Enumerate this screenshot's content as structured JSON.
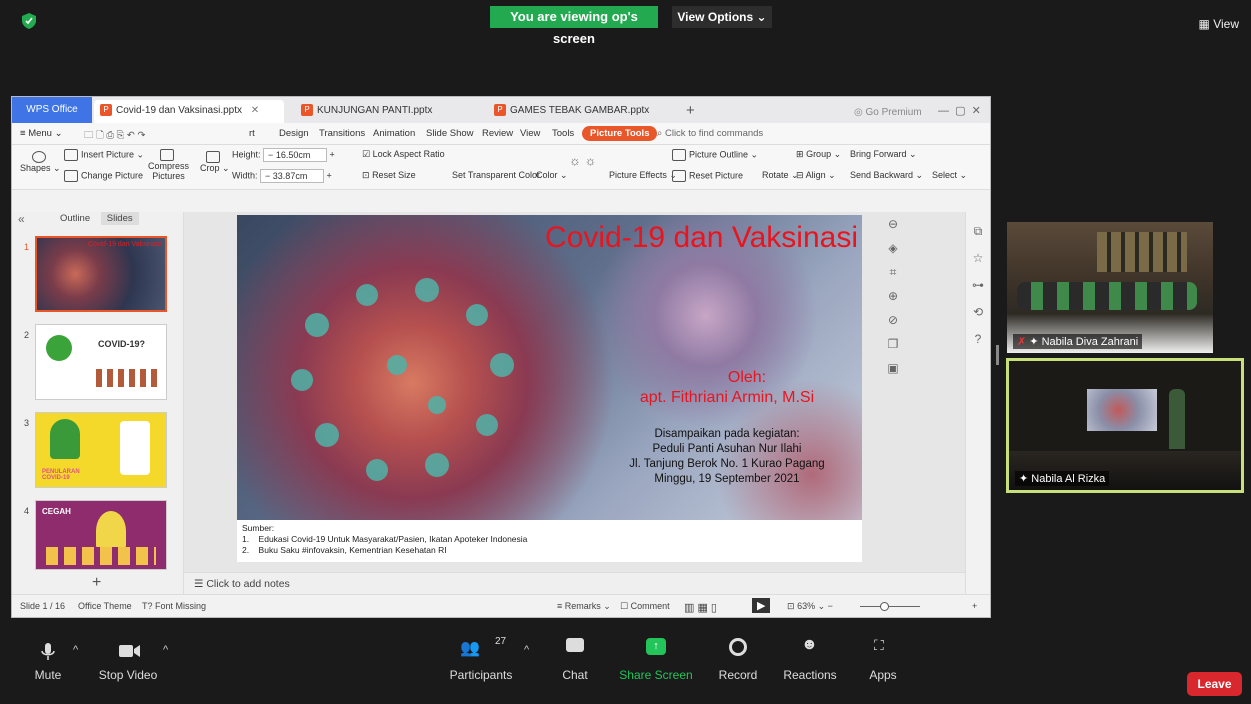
{
  "zoom": {
    "banner": "You are viewing op's screen",
    "view_options": "View Options",
    "view_button": "View",
    "toolbar": {
      "mute": "Mute",
      "stop_video": "Stop Video",
      "participants": "Participants",
      "participants_count": "27",
      "chat": "Chat",
      "share_screen": "Share Screen",
      "record": "Record",
      "reactions": "Reactions",
      "apps": "Apps",
      "leave": "Leave"
    },
    "participants": [
      {
        "name": "Nabila Diva Zahrani"
      },
      {
        "name": "Nabila Al Rizka"
      }
    ],
    "colors": {
      "banner": "#23a94f",
      "leave": "#d9272e",
      "active_speaker": "#c8e07a"
    }
  },
  "wps": {
    "tabs": [
      {
        "label": "WPS Office"
      },
      {
        "label": "Covid-19 dan Vaksinasi.pptx"
      },
      {
        "label": "KUNJUNGAN PANTI.pptx"
      },
      {
        "label": "GAMES TEBAK GAMBAR.pptx"
      }
    ],
    "go_premium": "Go Premium",
    "menu": {
      "menu": "Menu",
      "items": [
        "rt",
        "Design",
        "Transitions",
        "Animation",
        "Slide Show",
        "Review",
        "View",
        "Tools"
      ],
      "picture_tools": "Picture Tools",
      "search_placeholder": "Click to find commands"
    },
    "ribbon": {
      "shapes": "Shapes",
      "insert_picture": "Insert Picture",
      "change_picture": "Change Picture",
      "compress": "Compress",
      "pictures": "Pictures",
      "crop": "Crop",
      "height_label": "Height:",
      "height_value": "16.50cm",
      "width_label": "Width:",
      "width_value": "33.87cm",
      "lock_aspect": "Lock Aspect Ratio",
      "reset_size": "Reset Size",
      "set_transparent": "Set Transparent Color",
      "color": "Color",
      "picture_outline": "Picture Outline",
      "picture_effects": "Picture Effects",
      "reset_picture": "Reset Picture",
      "rotate": "Rotate",
      "group": "Group",
      "align": "Align",
      "bring_forward": "Bring Forward",
      "send_backward": "Send Backward",
      "select": "Select"
    },
    "panel": {
      "outline": "Outline",
      "slides": "Slides",
      "thumbs": [
        {
          "num": "1",
          "title": "Covid-19 dan Vaksinasi"
        },
        {
          "num": "2",
          "title": "COVID-19?"
        },
        {
          "num": "3",
          "title": "PENULARAN COVID-19"
        },
        {
          "num": "4",
          "title": "CEGAH"
        }
      ]
    },
    "slide": {
      "title": "Covid-19 dan Vaksinasi",
      "oleh": "Oleh:",
      "author": "apt. Fithriani Armin, M.Si",
      "event_lines": [
        "Disampaikan pada kegiatan:",
        "Peduli Panti Asuhan Nur Ilahi",
        "Jl. Tanjung Berok No. 1 Kurao Pagang",
        "Minggu, 19 September 2021"
      ],
      "sumber_label": "Sumber:",
      "sources": [
        {
          "n": "1.",
          "text": "Edukasi Covid-19 Untuk Masyarakat/Pasien, Ikatan Apoteker Indonesia"
        },
        {
          "n": "2.",
          "text": "Buku Saku #infovaksin, Kementrian Kesehatan RI"
        }
      ]
    },
    "add_notes": "Click to add notes",
    "status": {
      "slide_counter": "Slide 1 / 16",
      "theme": "Office Theme",
      "font_missing": "Font Missing",
      "remarks": "Remarks",
      "comment": "Comment",
      "zoom": "63%"
    }
  }
}
